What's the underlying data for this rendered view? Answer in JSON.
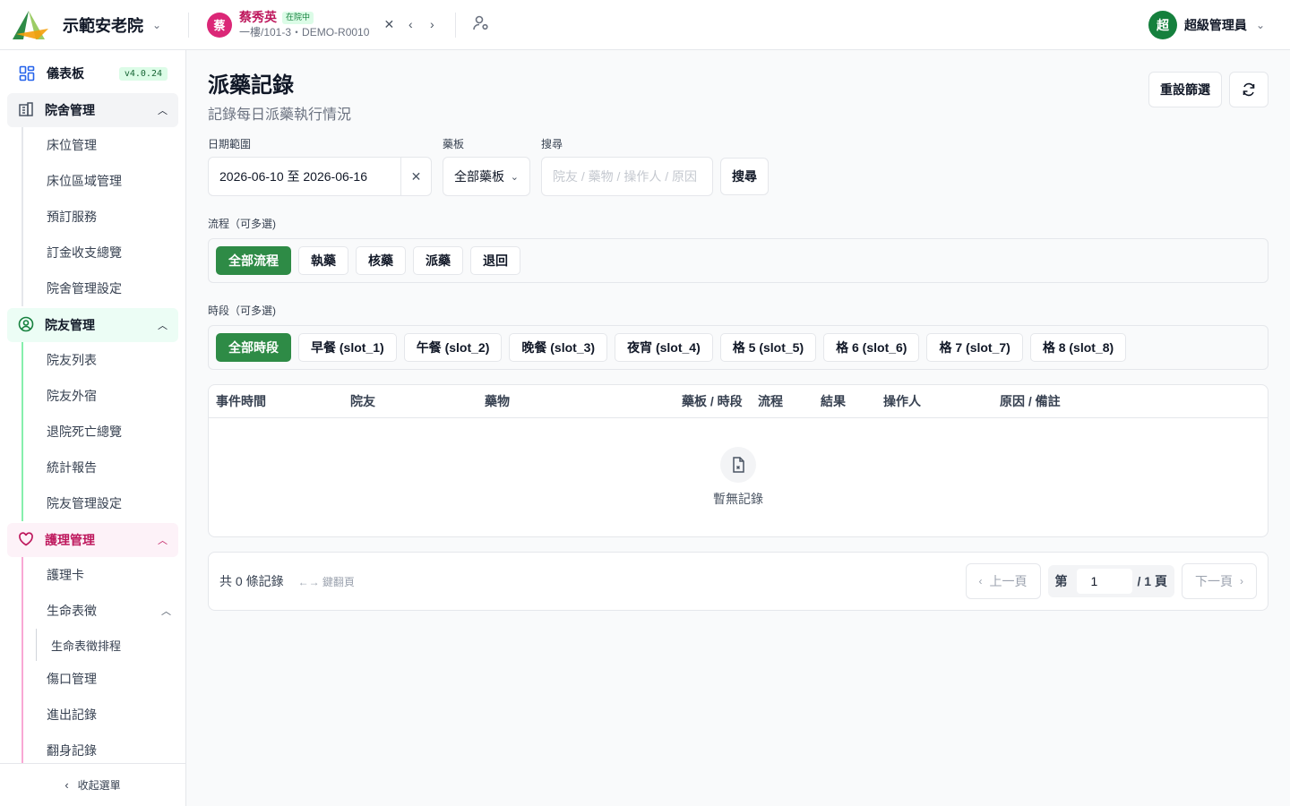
{
  "header": {
    "org_name": "示範安老院",
    "resident": {
      "avatar": "蔡",
      "name": "蔡秀英",
      "status": "在院中",
      "location": "一樓/101-3・DEMO-R0010"
    },
    "user": {
      "avatar": "超",
      "name": "超級管理員"
    }
  },
  "sidebar": {
    "dashboard": {
      "label": "儀表板",
      "version": "v4.0.24"
    },
    "groups": [
      {
        "label": "院舍管理",
        "items": [
          "床位管理",
          "床位區域管理",
          "預訂服務",
          "訂金收支總覽",
          "院舍管理設定"
        ]
      },
      {
        "label": "院友管理",
        "items": [
          "院友列表",
          "院友外宿",
          "退院死亡總覽",
          "統計報告",
          "院友管理設定"
        ]
      },
      {
        "label": "護理管理",
        "items": [
          "護理卡",
          "生命表徵",
          "生命表徵排程",
          "傷口管理",
          "進出記錄",
          "翻身記錄"
        ]
      }
    ],
    "collapse_label": "收起選單"
  },
  "page": {
    "title": "派藥記錄",
    "subtitle": "記錄每日派藥執行情況",
    "reset_label": "重設篩選"
  },
  "filters": {
    "date_label": "日期範圍",
    "date_value": "2026-06-10 至 2026-06-16",
    "tray_label": "藥板",
    "tray_value": "全部藥板",
    "search_label": "搜尋",
    "search_placeholder": "院友 / 藥物 / 操作人 / 原因",
    "search_button": "搜尋"
  },
  "process": {
    "label": "流程（可多選)",
    "chips": [
      "全部流程",
      "執藥",
      "核藥",
      "派藥",
      "退回"
    ]
  },
  "slots": {
    "label": "時段（可多選)",
    "chips": [
      "全部時段",
      "早餐 (slot_1)",
      "午餐 (slot_2)",
      "晚餐 (slot_3)",
      "夜宵 (slot_4)",
      "格 5 (slot_5)",
      "格 6 (slot_6)",
      "格 7 (slot_7)",
      "格 8 (slot_8)"
    ]
  },
  "table": {
    "columns": [
      "事件時間",
      "院友",
      "藥物",
      "藥板 / 時段",
      "流程",
      "結果",
      "操作人",
      "原因 / 備註"
    ],
    "empty_text": "暫無記錄"
  },
  "pagination": {
    "total": "共 0 條記錄",
    "hint": "←→ 鍵翻頁",
    "prev": "上一頁",
    "page_prefix": "第",
    "current_page": "1",
    "page_suffix": "/ 1 頁",
    "next": "下一頁"
  },
  "colors": {
    "primary_green": "#2e8b46",
    "resident_pink": "#db2777",
    "nursing_pink": "#be185d"
  }
}
